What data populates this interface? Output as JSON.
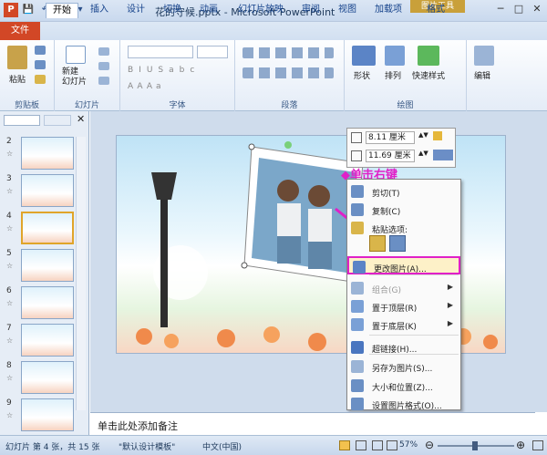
{
  "window": {
    "title": "花的守候.pptx - Microsoft PowerPoint",
    "context_tab": "图片工具"
  },
  "qat": {
    "save": "💾",
    "undo": "↶",
    "redo": "↻",
    "more": "▾"
  },
  "window_controls": [
    "─",
    "□",
    "✕"
  ],
  "tabs": {
    "file": "文件",
    "items": [
      "开始",
      "插入",
      "设计",
      "切换",
      "动画",
      "幻灯片放映",
      "审阅",
      "视图",
      "加载项",
      "格式"
    ],
    "active": "开始"
  },
  "ribbon": {
    "groups": [
      "剪贴板",
      "幻灯片",
      "字体",
      "段落",
      "绘图",
      ""
    ],
    "paste": "粘贴",
    "new_slide": "新建\n幻灯片",
    "shapes": "形状",
    "arrange": "排列",
    "quick_styles": "快速样式",
    "editing": "编辑"
  },
  "slides_pane": {
    "items": [
      {
        "num": "2"
      },
      {
        "num": "3"
      },
      {
        "num": "4"
      },
      {
        "num": "5"
      },
      {
        "num": "6"
      },
      {
        "num": "7"
      },
      {
        "num": "8"
      },
      {
        "num": "9"
      }
    ],
    "selected": "4"
  },
  "size_toolbar": {
    "height": "8.11 厘米",
    "width": "11.69 厘米"
  },
  "callout": "◆单击右键",
  "context_menu": {
    "items": [
      {
        "label": "剪切(T)",
        "icon": "scissors-icon"
      },
      {
        "label": "复制(C)",
        "icon": "copy-icon"
      },
      {
        "label": "粘贴选项:",
        "icon": "paste-icon"
      },
      {
        "label": "更改图片(A)...",
        "icon": "change-picture-icon"
      },
      {
        "label": "组合(G)",
        "icon": "group-icon"
      },
      {
        "label": "置于顶层(R)",
        "icon": "bring-front-icon"
      },
      {
        "label": "置于底层(K)",
        "icon": "send-back-icon"
      },
      {
        "label": "超链接(H)...",
        "icon": "hyperlink-icon"
      },
      {
        "label": "另存为图片(S)...",
        "icon": "save-picture-icon"
      },
      {
        "label": "大小和位置(Z)...",
        "icon": "size-position-icon"
      },
      {
        "label": "设置图片格式(O)...",
        "icon": "format-picture-icon"
      }
    ]
  },
  "notes": {
    "placeholder": "单击此处添加备注"
  },
  "status": {
    "slide_info": "幻灯片 第 4 张，共 15 张",
    "theme": "\"默认设计模板\"",
    "language": "中文(中国)",
    "zoom": "57%"
  },
  "colors": {
    "file_tab": "#d24726",
    "highlight_border": "#e020c8",
    "context_tab": "#c9a03a"
  }
}
